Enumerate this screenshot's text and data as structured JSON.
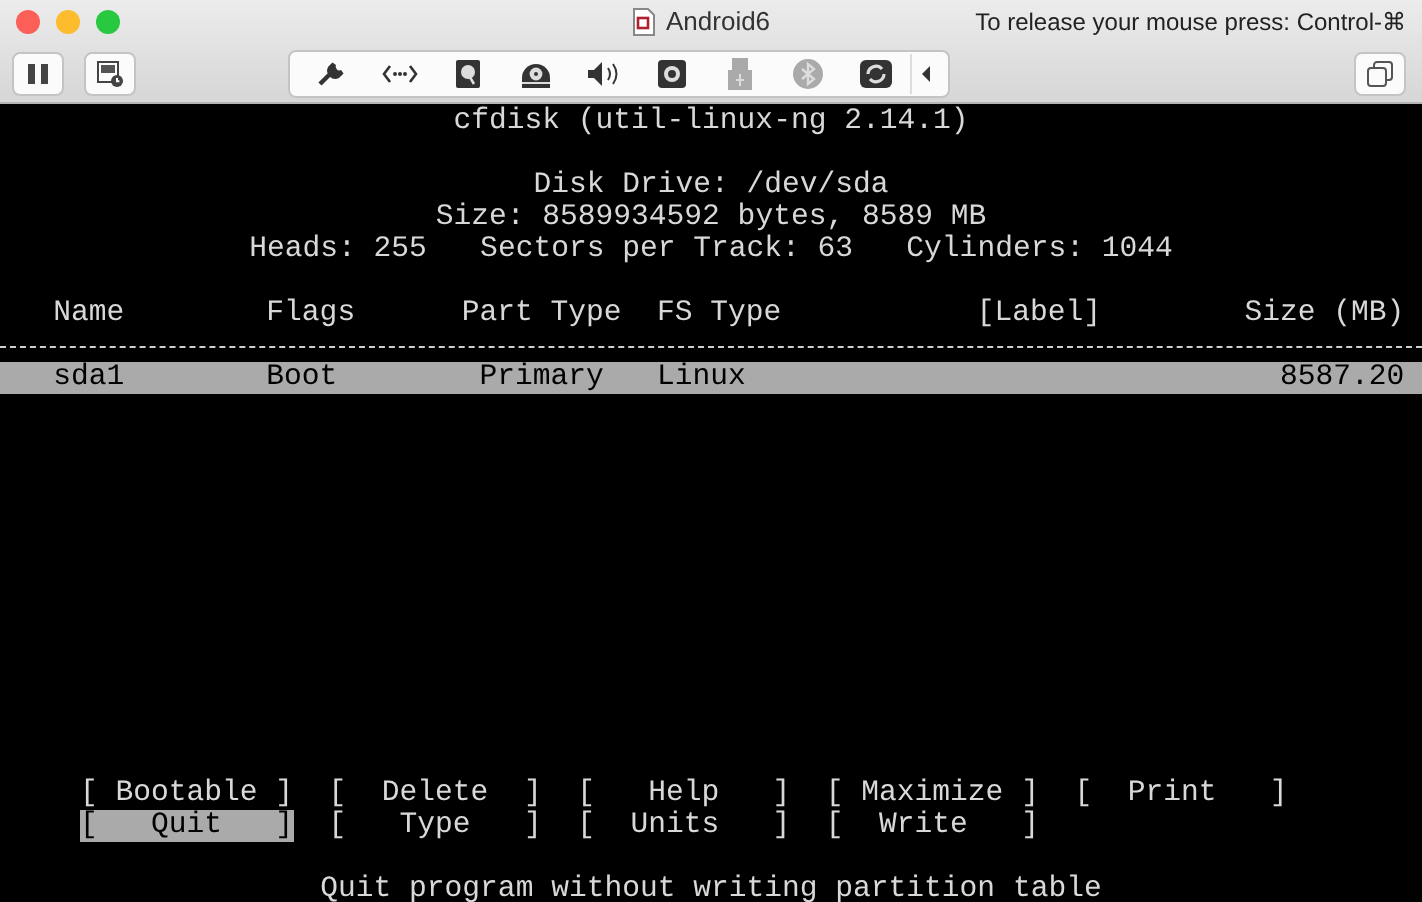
{
  "window": {
    "title": "Android6",
    "hint": "To release your mouse press: Control-⌘"
  },
  "toolbar": [
    {
      "kind": "wrench",
      "disabled": false
    },
    {
      "kind": "network",
      "disabled": false
    },
    {
      "kind": "disk",
      "disabled": false
    },
    {
      "kind": "optical",
      "disabled": false
    },
    {
      "kind": "speaker",
      "disabled": false
    },
    {
      "kind": "camera",
      "disabled": false
    },
    {
      "kind": "usb",
      "disabled": true
    },
    {
      "kind": "bluetooth",
      "disabled": true
    },
    {
      "kind": "shared",
      "disabled": false
    },
    {
      "kind": "collapse",
      "disabled": false
    }
  ],
  "terminal": {
    "title": "cfdisk (util-linux-ng 2.14.1)",
    "disk_info": [
      "Disk Drive: /dev/sda",
      "Size: 8589934592 bytes, 8589 MB",
      "Heads: 255   Sectors per Track: 63   Cylinders: 1044"
    ],
    "table": {
      "columns": [
        "Name",
        "Flags",
        "Part Type",
        "FS Type",
        "[Label]",
        "Size (MB)"
      ],
      "rows": [
        {
          "cells": [
            "sda1",
            "Boot",
            "Primary",
            "Linux",
            "",
            "8587.20"
          ],
          "selected": true
        }
      ]
    },
    "menu": [
      [
        {
          "label": "[ Bootable ]",
          "selected": false
        },
        {
          "label": "[  Delete  ]",
          "selected": false
        },
        {
          "label": "[   Help   ]",
          "selected": false
        },
        {
          "label": "[ Maximize ]",
          "selected": false
        },
        {
          "label": "[  Print   ]",
          "selected": false
        }
      ],
      [
        {
          "label": "[   Quit   ]",
          "selected": true
        },
        {
          "label": "[   Type   ]",
          "selected": false
        },
        {
          "label": "[  Units   ]",
          "selected": false
        },
        {
          "label": "[  Write   ]",
          "selected": false
        }
      ]
    ],
    "status": "Quit program without writing partition table"
  }
}
